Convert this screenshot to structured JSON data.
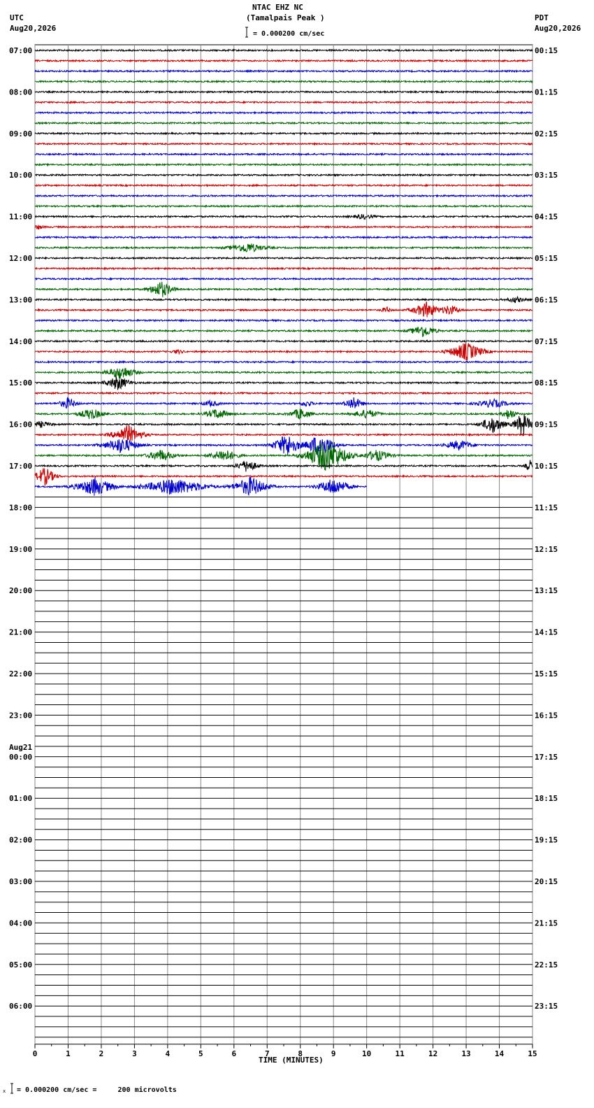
{
  "header": {
    "station": "NTAC EHZ NC",
    "location": "(Tamalpais Peak )",
    "left_tz": "UTC",
    "left_date": "Aug20,2026",
    "right_tz": "PDT",
    "right_date": "Aug20,2026",
    "scale": "= 0.000200 cm/sec"
  },
  "footer": {
    "scale_note": "= 0.000200 cm/sec =     200 microvolts"
  },
  "chart_data": {
    "type": "line",
    "title": "NTAC EHZ NC (Tamalpais Peak )",
    "xlabel": "TIME (MINUTES)",
    "x_ticks": [
      "0",
      "1",
      "2",
      "3",
      "4",
      "5",
      "6",
      "7",
      "8",
      "9",
      "10",
      "11",
      "12",
      "13",
      "14",
      "15"
    ],
    "xlim": [
      0,
      15
    ],
    "trace_minutes_per_line": 15,
    "lines_per_hour": 4,
    "trace_colors": [
      "#000000",
      "#cc0000",
      "#0000cc",
      "#006600"
    ],
    "left_hour_labels": [
      {
        "row": 0,
        "label": "07:00"
      },
      {
        "row": 4,
        "label": "08:00"
      },
      {
        "row": 8,
        "label": "09:00"
      },
      {
        "row": 12,
        "label": "10:00"
      },
      {
        "row": 16,
        "label": "11:00"
      },
      {
        "row": 20,
        "label": "12:00"
      },
      {
        "row": 24,
        "label": "13:00"
      },
      {
        "row": 28,
        "label": "14:00"
      },
      {
        "row": 32,
        "label": "15:00"
      },
      {
        "row": 36,
        "label": "16:00"
      },
      {
        "row": 40,
        "label": "17:00"
      },
      {
        "row": 44,
        "label": "18:00"
      },
      {
        "row": 48,
        "label": "19:00"
      },
      {
        "row": 52,
        "label": "20:00"
      },
      {
        "row": 56,
        "label": "21:00"
      },
      {
        "row": 60,
        "label": "22:00"
      },
      {
        "row": 64,
        "label": "23:00"
      },
      {
        "row": 68,
        "label": "00:00",
        "date": "Aug21"
      },
      {
        "row": 72,
        "label": "01:00"
      },
      {
        "row": 76,
        "label": "02:00"
      },
      {
        "row": 80,
        "label": "03:00"
      },
      {
        "row": 84,
        "label": "04:00"
      },
      {
        "row": 88,
        "label": "05:00"
      },
      {
        "row": 92,
        "label": "06:00"
      }
    ],
    "right_hour_labels": [
      "00:15",
      "01:15",
      "02:15",
      "03:15",
      "04:15",
      "05:15",
      "06:15",
      "07:15",
      "08:15",
      "09:15",
      "10:15",
      "11:15",
      "12:15",
      "13:15",
      "14:15",
      "15:15",
      "16:15",
      "17:15",
      "18:15",
      "19:15",
      "20:15",
      "21:15",
      "22:15",
      "23:15"
    ],
    "total_rows": 96,
    "active_rows": 43,
    "last_trace_end_minute": 10,
    "events": [
      {
        "row": 16,
        "minute": 9.9,
        "amplitude": 3,
        "duration": 0.6
      },
      {
        "row": 17,
        "minute": 0.1,
        "amplitude": 3,
        "duration": 0.3
      },
      {
        "row": 19,
        "minute": 6.4,
        "amplitude": 7,
        "duration": 1.0
      },
      {
        "row": 23,
        "minute": 3.8,
        "amplitude": 12,
        "duration": 0.7
      },
      {
        "row": 24,
        "minute": 14.5,
        "amplitude": 4,
        "duration": 0.5
      },
      {
        "row": 25,
        "minute": 10.6,
        "amplitude": 4,
        "duration": 0.3
      },
      {
        "row": 25,
        "minute": 11.8,
        "amplitude": 11,
        "duration": 0.8
      },
      {
        "row": 25,
        "minute": 12.5,
        "amplitude": 7,
        "duration": 0.6
      },
      {
        "row": 27,
        "minute": 11.7,
        "amplitude": 9,
        "duration": 0.7
      },
      {
        "row": 29,
        "minute": 13.0,
        "amplitude": 13,
        "duration": 1.0
      },
      {
        "row": 29,
        "minute": 4.3,
        "amplitude": 3,
        "duration": 0.3
      },
      {
        "row": 31,
        "minute": 2.6,
        "amplitude": 10,
        "duration": 0.8
      },
      {
        "row": 32,
        "minute": 2.5,
        "amplitude": 10,
        "duration": 0.7
      },
      {
        "row": 34,
        "minute": 1.0,
        "amplitude": 8,
        "duration": 0.5
      },
      {
        "row": 34,
        "minute": 5.3,
        "amplitude": 4,
        "duration": 0.5
      },
      {
        "row": 34,
        "minute": 8.2,
        "amplitude": 4,
        "duration": 0.4
      },
      {
        "row": 34,
        "minute": 9.6,
        "amplitude": 10,
        "duration": 0.5
      },
      {
        "row": 34,
        "minute": 13.8,
        "amplitude": 6,
        "duration": 0.9
      },
      {
        "row": 35,
        "minute": 1.7,
        "amplitude": 8,
        "duration": 0.7
      },
      {
        "row": 35,
        "minute": 5.5,
        "amplitude": 7,
        "duration": 0.7
      },
      {
        "row": 35,
        "minute": 8.0,
        "amplitude": 8,
        "duration": 0.6
      },
      {
        "row": 35,
        "minute": 10.0,
        "amplitude": 6,
        "duration": 0.8
      },
      {
        "row": 35,
        "minute": 14.3,
        "amplitude": 8,
        "duration": 0.4
      },
      {
        "row": 36,
        "minute": 0.2,
        "amplitude": 4,
        "duration": 0.6
      },
      {
        "row": 36,
        "minute": 13.8,
        "amplitude": 12,
        "duration": 0.7
      },
      {
        "row": 36,
        "minute": 14.7,
        "amplitude": 18,
        "duration": 0.5
      },
      {
        "row": 37,
        "minute": 2.8,
        "amplitude": 13,
        "duration": 0.9
      },
      {
        "row": 38,
        "minute": 2.6,
        "amplitude": 11,
        "duration": 1.0
      },
      {
        "row": 38,
        "minute": 7.6,
        "amplitude": 16,
        "duration": 0.8
      },
      {
        "row": 38,
        "minute": 8.6,
        "amplitude": 18,
        "duration": 0.8
      },
      {
        "row": 38,
        "minute": 12.8,
        "amplitude": 7,
        "duration": 0.8
      },
      {
        "row": 39,
        "minute": 3.8,
        "amplitude": 8,
        "duration": 0.8
      },
      {
        "row": 39,
        "minute": 5.7,
        "amplitude": 9,
        "duration": 0.8
      },
      {
        "row": 39,
        "minute": 8.8,
        "amplitude": 24,
        "duration": 1.2
      },
      {
        "row": 39,
        "minute": 10.3,
        "amplitude": 8,
        "duration": 0.8
      },
      {
        "row": 40,
        "minute": 6.4,
        "amplitude": 9,
        "duration": 0.6
      },
      {
        "row": 40,
        "minute": 14.9,
        "amplitude": 10,
        "duration": 0.2
      },
      {
        "row": 41,
        "minute": 0.3,
        "amplitude": 13,
        "duration": 0.6
      },
      {
        "row": 42,
        "minute": 1.8,
        "amplitude": 13,
        "duration": 1.1
      },
      {
        "row": 42,
        "minute": 4.2,
        "amplitude": 12,
        "duration": 1.8
      },
      {
        "row": 42,
        "minute": 6.5,
        "amplitude": 14,
        "duration": 1.0
      },
      {
        "row": 42,
        "minute": 9.0,
        "amplitude": 12,
        "duration": 0.9
      }
    ]
  }
}
